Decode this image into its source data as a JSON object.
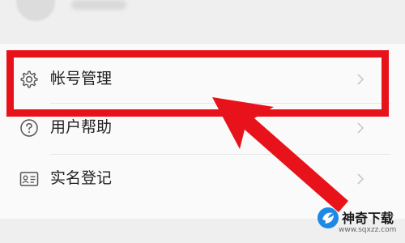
{
  "menu": {
    "items": [
      {
        "label": "帐号管理",
        "icon": "gear-icon",
        "highlighted": true
      },
      {
        "label": "用户帮助",
        "icon": "question-circle-icon",
        "highlighted": false
      },
      {
        "label": "实名登记",
        "icon": "id-card-icon",
        "highlighted": false
      }
    ]
  },
  "watermark": {
    "title": "神奇下载",
    "url": "www.sqxzz.com"
  },
  "colors": {
    "highlight": "#e8121b",
    "icon": "#555555",
    "chevron": "#c8c8c8",
    "card_bg": "#fafafa",
    "page_bg": "#efefef"
  }
}
